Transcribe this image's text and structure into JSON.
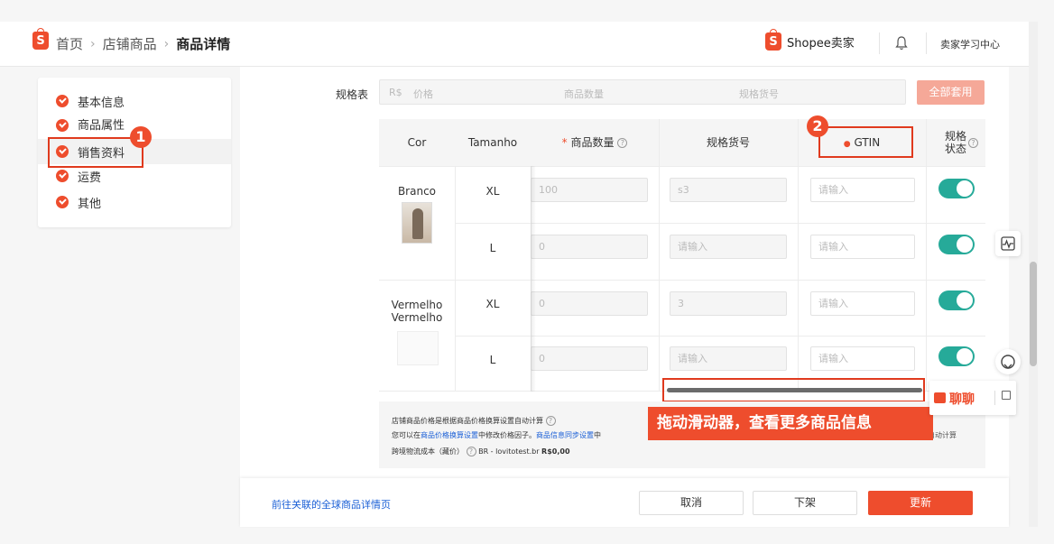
{
  "header": {
    "breadcrumbs": [
      "首页",
      "店铺商品",
      "商品详情"
    ],
    "separator": "›",
    "seller_brand": "Shopee卖家",
    "learning_center": "卖家学习中心",
    "logo_letter": "S"
  },
  "sidebar": {
    "items": [
      {
        "label": "基本信息",
        "checked": true
      },
      {
        "label": "商品属性",
        "checked": true
      },
      {
        "label": "销售资料",
        "checked": true,
        "active": true
      },
      {
        "label": "运费",
        "checked": true
      },
      {
        "label": "其他",
        "checked": true
      }
    ]
  },
  "spec_table": {
    "label": "规格表",
    "price_prefix": "R$",
    "price_placeholder": "价格",
    "quantity_placeholder": "商品数量",
    "sku_placeholder": "规格货号",
    "apply_all": "全部套用"
  },
  "table": {
    "columns": {
      "cor": "Cor",
      "tamanho": "Tamanho",
      "quantity_req": "*",
      "quantity": "商品数量",
      "sku": "规格货号",
      "gtin_req": "●",
      "gtin": "GTIN",
      "status_line1": "规格",
      "status_line2": "状态",
      "help": "?"
    },
    "groups": [
      {
        "cor": "Branco",
        "rows": [
          {
            "tamanho": "XL",
            "quantity": "100",
            "sku": "s3",
            "gtin": "请输入",
            "enabled": true
          },
          {
            "tamanho": "L",
            "quantity": "0",
            "sku": "请输入",
            "gtin": "请输入",
            "enabled": true
          }
        ]
      },
      {
        "cor": "Vermelho\nVermelho",
        "rows": [
          {
            "tamanho": "XL",
            "quantity": "0",
            "sku": "3",
            "gtin": "请输入",
            "enabled": true
          },
          {
            "tamanho": "L",
            "quantity": "0",
            "sku": "请输入",
            "gtin": "请输入",
            "enabled": true
          }
        ]
      }
    ]
  },
  "info": {
    "line1": "店铺商品价格是根据商品价格换算设置自动计算",
    "line2_a": "您可以在",
    "line2_link1": "商品价格换算设置",
    "line2_b": "中修改价格因子。",
    "line2_link2": "商品信息同步设置",
    "line2_c": "中",
    "line2_right": "自动计算",
    "line3_label": "跨境物流成本（藏价）",
    "line3_value": "BR - lovitotest.br",
    "line3_amount": "R$0,00"
  },
  "annotations": {
    "badge1": "1",
    "badge2": "2",
    "drag_hint": "拖动滑动器，查看更多商品信息"
  },
  "footer": {
    "global_link": "前往关联的全球商品详情页",
    "cancel": "取消",
    "delist": "下架",
    "update": "更新"
  },
  "chat": {
    "label": "聊聊"
  },
  "colors": {
    "brand": "#ee4d2d",
    "toggle_on": "#26aa99",
    "link": "#1a5fd6"
  }
}
